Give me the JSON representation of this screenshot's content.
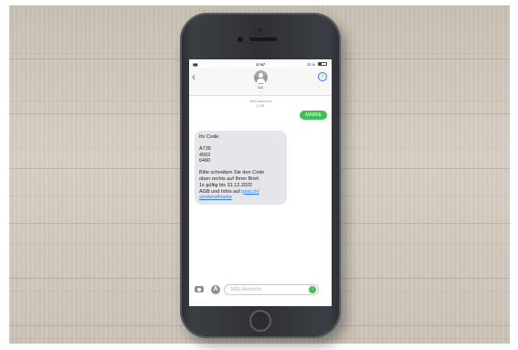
{
  "status_bar": {
    "time": "17:57",
    "battery": "33 %"
  },
  "header": {
    "contact": "414"
  },
  "conversation": {
    "meta_label": "SMS-Nachricht",
    "meta_time": "17:58",
    "outgoing_message": "MARKE",
    "incoming": {
      "greeting": "Ihr Code:",
      "code_lines": [
        "A735",
        "4002",
        "6460"
      ],
      "instruction_lines": [
        "Bitte schreiben Sie den Code",
        "oben rechts auf Ihren Brief.",
        "1x gültig bis 31.12.2022",
        "AGB und Infos auf "
      ],
      "link_part1": "post.ch/",
      "link_part2": "smsbriefmarke"
    }
  },
  "input": {
    "placeholder": "SMS-Nachricht"
  },
  "icons": {
    "back": "chevron-left-icon",
    "info": "info-icon",
    "camera": "camera-icon",
    "apps": "app-store-icon",
    "send": "send-arrow-icon"
  },
  "colors": {
    "accent": "#2a7cf5",
    "sms_green": "#3ac153",
    "bubble_gray": "#e6e6ea"
  }
}
